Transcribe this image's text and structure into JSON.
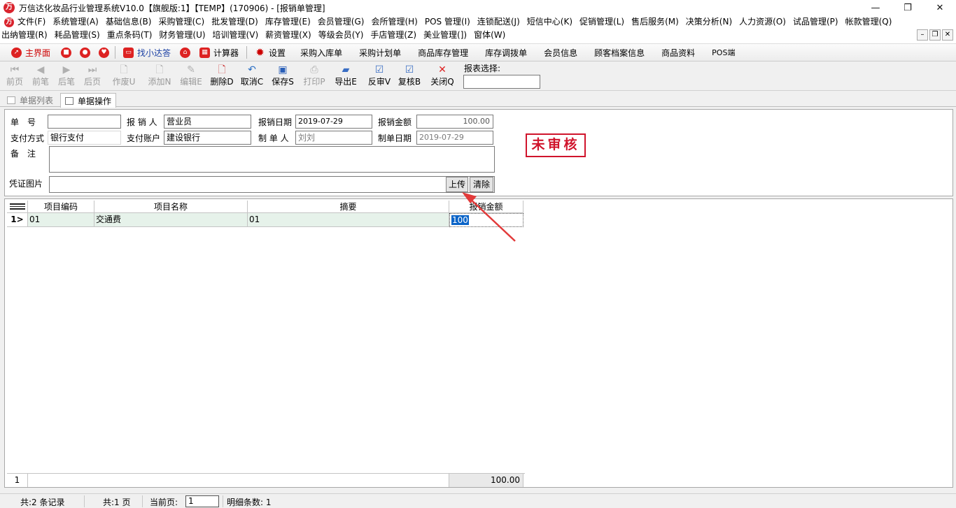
{
  "window": {
    "title": "万信达化妆品行业管理系统V10.0【旗舰版:1】【TEMP】(170906) - [报销单管理]",
    "minimize": "—",
    "restore": "❐",
    "close": "✕"
  },
  "menu": {
    "row1": [
      "文件(F)",
      "系统管理(A)",
      "基础信息(B)",
      "采购管理(C)",
      "批发管理(D)",
      "库存管理(E)",
      "会员管理(G)",
      "会所管理(H)",
      "POS 管理(I)",
      "连锁配送(J)",
      "短信中心(K)",
      "促销管理(L)",
      "售后服务(M)",
      "决策分析(N)",
      "人力资源(O)",
      "试品管理(P)",
      "帐款管理(Q)"
    ],
    "row2": [
      "出纳管理(R)",
      "耗品管理(S)",
      "重点条码(T)",
      "财务管理(U)",
      "培训管理(V)",
      "薪资管理(X)",
      "等级会员(Y)",
      "手店管理(Z)",
      "美业管理(])",
      "窗体(W)"
    ]
  },
  "quickbar": {
    "home": "主界面",
    "find": "找小达答",
    "calc": "计算器",
    "settings": "设置",
    "links": [
      "采购入库单",
      "采购计划单",
      "商品库存管理",
      "库存调拨单",
      "会员信息",
      "顾客档案信息",
      "商品资料",
      "POS端"
    ]
  },
  "toolbar": {
    "first": "前页",
    "prev": "前笔",
    "next": "后笔",
    "last": "后页",
    "void": "作废U",
    "add": "添加N",
    "edit": "编辑E",
    "delete": "删除D",
    "cancel": "取消C",
    "save": "保存S",
    "print": "打印P",
    "export": "导出E",
    "unaudit": "反审V",
    "review": "复核B",
    "close": "关闭Q",
    "report_label": "报表选择:",
    "report_value": ""
  },
  "tabs": {
    "list": "单据列表",
    "operate": "单据操作"
  },
  "form": {
    "doc_no_label": "单　号",
    "doc_no": "",
    "applicant_label": "报 销 人",
    "applicant": "营业员",
    "date_label": "报销日期",
    "date": "2019-07-29",
    "amount_label": "报销金额",
    "amount": "100.00",
    "pay_method_label": "支付方式",
    "pay_method": "银行支付",
    "pay_account_label": "支付账户",
    "pay_account": "建设银行",
    "maker_label": "制 单 人",
    "maker": "刘刘",
    "make_date_label": "制单日期",
    "make_date": "2019-07-29",
    "remark_label": "备　注",
    "remark": "",
    "voucher_label": "凭证图片",
    "voucher": "",
    "upload": "上传",
    "clear": "清除",
    "stamp": "未审核"
  },
  "grid": {
    "columns": [
      "项目编码",
      "项目名称",
      "摘要",
      "报销金额"
    ],
    "rows": [
      {
        "indicator": "1>",
        "code": "01",
        "name": "交通费",
        "summary": "01",
        "amount": "100"
      }
    ],
    "footer": {
      "count": "1",
      "total": "100.00"
    }
  },
  "status": {
    "records": "共:2 条记录",
    "pages": "共:1 页",
    "current_label": "当前页:",
    "current": "1",
    "detail": "明细条数: 1"
  },
  "colors": {
    "accent_red": "#d0142c",
    "selection_blue": "#0a64c8",
    "row_green": "#e6f2ea"
  }
}
